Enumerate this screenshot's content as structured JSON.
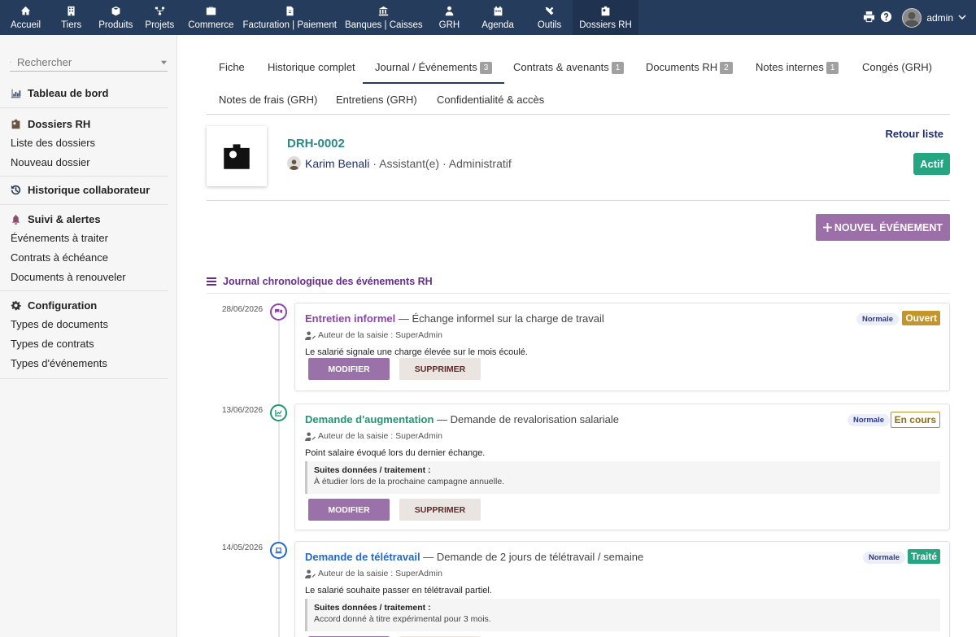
{
  "topnav": {
    "items": [
      {
        "label": "Accueil",
        "icon": "home-icon"
      },
      {
        "label": "Tiers",
        "icon": "building-icon"
      },
      {
        "label": "Produits",
        "icon": "cube-icon"
      },
      {
        "label": "Projets",
        "icon": "sitemap-icon"
      },
      {
        "label": "Commerce",
        "icon": "briefcase-icon"
      },
      {
        "label": "Facturation | Paiement",
        "icon": "invoice-icon"
      },
      {
        "label": "Banques | Caisses",
        "icon": "bank-icon"
      },
      {
        "label": "GRH",
        "icon": "user-tie-icon"
      },
      {
        "label": "Agenda",
        "icon": "calendar-icon"
      },
      {
        "label": "Outils",
        "icon": "tools-icon"
      },
      {
        "label": "Dossiers RH",
        "icon": "id-badge-icon"
      }
    ],
    "active": "Dossiers RH",
    "username": "admin"
  },
  "sidebar": {
    "search_placeholder": "Rechercher",
    "dashboard": "Tableau de bord",
    "dossiers": {
      "title": "Dossiers RH",
      "items": [
        "Liste des dossiers",
        "Nouveau dossier"
      ]
    },
    "historique": "Historique collaborateur",
    "suivi": {
      "title": "Suivi & alertes",
      "items": [
        "Événements à traiter",
        "Contrats à échéance",
        "Documents à renouveler"
      ]
    },
    "config": {
      "title": "Configuration",
      "items": [
        "Types de documents",
        "Types de contrats",
        "Types d'événements"
      ]
    }
  },
  "tabs": [
    {
      "label": "Fiche"
    },
    {
      "label": "Historique complet"
    },
    {
      "label": "Journal / Événements",
      "count": "3"
    },
    {
      "label": "Contrats & avenants",
      "count": "1"
    },
    {
      "label": "Documents RH",
      "count": "2"
    },
    {
      "label": "Notes internes",
      "count": "1"
    },
    {
      "label": "Congés (GRH)"
    },
    {
      "label": "Notes de frais (GRH)"
    },
    {
      "label": "Entretiens (GRH)"
    },
    {
      "label": "Confidentialité & accès"
    }
  ],
  "dossier": {
    "ref": "DRH-0002",
    "name": "Karim Benali",
    "details": "· Assistant(e) · Administratif",
    "status": "Actif",
    "back_label": "Retour liste"
  },
  "new_event_label": "NOUVEL ÉVÉNEMENT",
  "journal_title": "Journal chronologique des événements RH",
  "colors": {
    "nav": "#263c5c",
    "purple": "#9c6fa8",
    "teal": "#2a8a89",
    "green": "#25a580"
  },
  "events": [
    {
      "date": "28/06/2026",
      "type": "Entretien informel",
      "summary": "— Échange informel sur la charge de travail",
      "author": "Auteur de la saisie : SuperAdmin",
      "description": "Le salarié signale une charge élevée sur le mois écoulé.",
      "priority": "Normale",
      "status": "Ouvert",
      "type_color": "#8e44ad",
      "status_color": "#c4952a",
      "icon": "comments-icon"
    },
    {
      "date": "13/06/2026",
      "type": "Demande d'augmentation",
      "summary": "— Demande de revalorisation salariale",
      "author": "Auteur de la saisie : SuperAdmin",
      "description": "Point salaire évoqué lors du dernier échange.",
      "followup_label": "Suites données / traitement :",
      "followup": "À étudier lors de la prochaine campagne annuelle.",
      "priority": "Normale",
      "status": "En cours",
      "type_color": "#1f9770",
      "status_color": "#b8932a",
      "icon": "chart-line-icon"
    },
    {
      "date": "14/05/2026",
      "type": "Demande de télétravail",
      "summary": "— Demande de 2 jours de télétravail / semaine",
      "author": "Auteur de la saisie : SuperAdmin",
      "description": "Le salarié souhaite passer en télétravail partiel.",
      "followup_label": "Suites données / traitement :",
      "followup": "Accord donné à titre expérimental pour 3 mois.",
      "priority": "Normale",
      "status": "Traité",
      "type_color": "#2468c4",
      "status_color": "#25a580",
      "icon": "laptop-icon"
    }
  ],
  "buttons": {
    "modify": "MODIFIER",
    "delete": "SUPPRIMER"
  }
}
